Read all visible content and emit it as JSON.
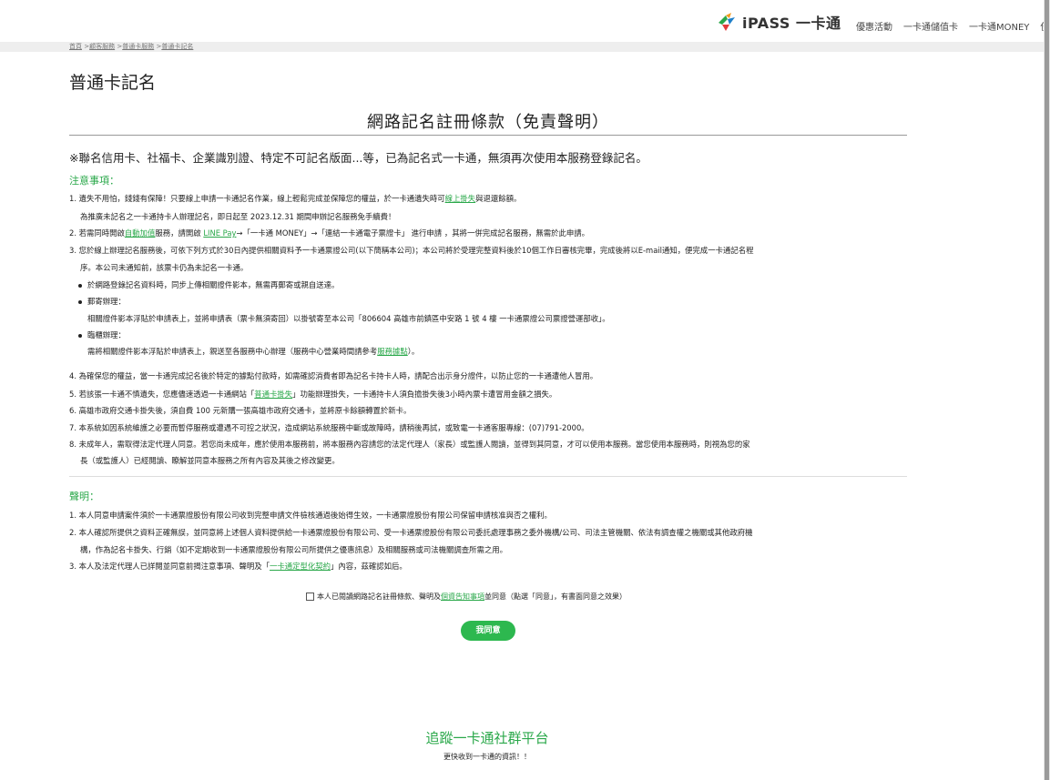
{
  "header": {
    "logo_text": "iPASS 一卡通",
    "nav": [
      "優惠活動",
      "一卡通儲值卡",
      "一卡通MONEY",
      "使"
    ]
  },
  "breadcrumb": [
    "首頁",
    "顧客服務",
    "普通卡服務",
    "普通卡記名"
  ],
  "page_title": "普通卡記名",
  "terms_title": "網路記名註冊條款（免責聲明）",
  "notice": "※聯名信用卡、社福卡、企業識別證、特定不可記名版面...等，已為記名式一卡通，無須再次使用本服務登錄記名。",
  "notes": {
    "heading": "注意事項：",
    "item1": {
      "pre": "1. 遺失不用怕，錢錢有保障！只要線上申請一卡通記名作業，線上輕鬆完成並保障您的權益，於一卡通遺失時可",
      "link": "線上掛失",
      "post": "與退還餘額。",
      "line2": "為推廣未記名之一卡通持卡人辦理記名，即日起至 2023.12.31 期間申辦記名服務免手續費！"
    },
    "item2": {
      "pre": "2. 若需同時開啟",
      "link1": "自動加值",
      "mid1": "服務，請開啟 ",
      "link2": "LINE Pay",
      "post": "→「一卡通 MONEY」→「連結一卡通電子票證卡」 進行申請 ，其將一併完成記名服務，無需於此申請。"
    },
    "item3": {
      "line1": "3. 您於線上辦理記名服務後，可依下列方式於30日內提供相關資料予一卡通票證公司(以下簡稱本公司)；本公司將於受理完整資料後於10個工作日審核完畢，完成後將以E-mail通知，便完成一卡通記名程",
      "line2": "序。本公司未通知前，該票卡仍為未記名一卡通。",
      "bullet1": "於網路登錄記名資料時，同步上傳相關證件影本，無需再郵寄或親自送達。",
      "bullet2": "郵寄辦理：",
      "bullet2_text": "相關證件影本浮貼於申請表上，並將申請表（票卡無須寄回）以掛號寄至本公司「806604 高雄市前鎮區中安路 1 號 4 樓 一卡通票證公司票證營運部收」。",
      "bullet3": "臨櫃辦理：",
      "bullet3_pre": "需將相關證件影本浮貼於申請表上，親送至各服務中心辦理（服務中心營業時間請參考",
      "bullet3_link": "服務據點",
      "bullet3_post": "）。"
    },
    "item4": "4. 為確保您的權益，當一卡通完成記名後於特定的據點付款時，如需確認消費者即為記名卡持卡人時，請配合出示身分證件，以防止您的一卡通遭他人冒用。",
    "item5": {
      "pre": "5. 若該張一卡通不慎遺失，您應儘速透過一卡通網站「",
      "link": "普通卡掛失",
      "post": "」功能辦理掛失，一卡通持卡人須負擔掛失後3小時內票卡遭冒用金額之損失。"
    },
    "item6": "6. 高雄市政府交通卡掛失後，須自費 100 元新購一張高雄市政府交通卡，並將原卡餘額轉置於新卡。",
    "item7": "7. 本系統如因系統維護之必要而暫停服務或遭遇不可控之狀況，造成網站系統服務中斷或故障時，請稍後再試，或致電一卡通客服專線：(07)791-2000。",
    "item8": {
      "line1": "8. 未成年人，需取得法定代理人同意。若您尚未成年，應於使用本服務前，將本服務內容請您的法定代理人（家長）或監護人閱讀，並得到其同意，才可以使用本服務。當您使用本服務時，則視為您的家",
      "line2": "長（或監護人）已經閱讀、瞭解並同意本服務之所有內容及其後之修改變更。"
    }
  },
  "declaration": {
    "heading": "聲明：",
    "item1": "1. 本人同意申請案件須於一卡通票證股份有限公司收到完整申請文件檢核通過後始得生效，一卡通票證股份有限公司保留申請核准與否之權利。",
    "item2_line1": "2. 本人確認所提供之資料正確無誤，並同意將上述個人資料提供給一卡通票證股份有限公司、受一卡通票證股份有限公司委託處理事務之委外機構/公司、司法主管機關、依法有調查權之機關或其他政府機",
    "item2_line2": "構，作為記名卡掛失、行銷（如不定期收到一卡通票證股份有限公司所提供之優惠訊息）及相關服務或司法機關調查所需之用。",
    "item3_pre": "3. 本人及法定代理人已詳閱並同意前揭注意事項、聲明及「",
    "item3_link": "一卡通定型化契約",
    "item3_post": "」內容，茲確認如后。"
  },
  "agree": {
    "pre": "本人已閱讀網路記名註冊條款、聲明及",
    "link": "個資告知事項",
    "post": "並同意（點選「同意」，有書面同意之效果）",
    "button": "我同意"
  },
  "footer": {
    "title": "追蹤一卡通社群平台",
    "subtitle": "更快收到一卡通的資訊！！"
  },
  "colors": {
    "accent": "#2aa84a",
    "button": "#2db84f"
  }
}
